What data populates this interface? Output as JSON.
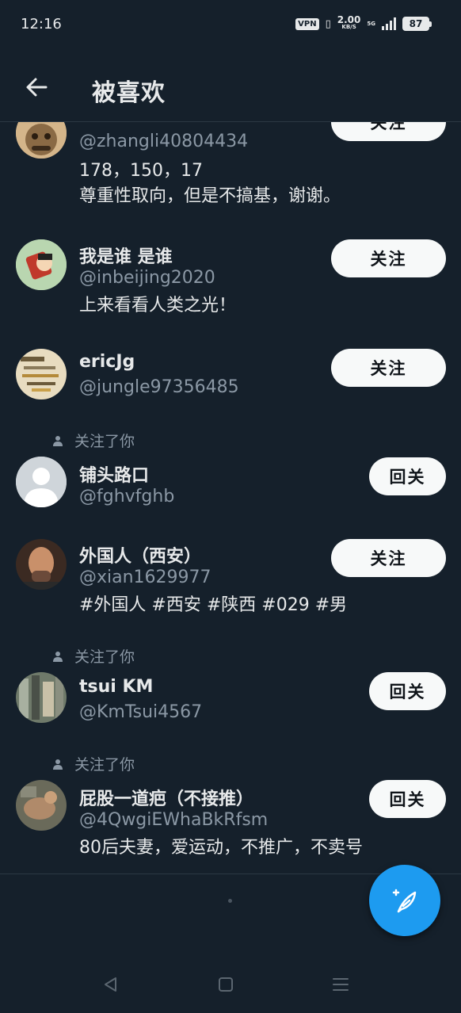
{
  "status_bar": {
    "time": "12:16",
    "vpn": "VPN",
    "speed_value": "2.00",
    "speed_unit": "KB/S",
    "network": "5G",
    "battery": "87"
  },
  "header": {
    "title": "被喜欢"
  },
  "users": [
    {
      "name": "",
      "handle": "@zhangli40804434",
      "bio_lines": [
        "178，150，17",
        "尊重性取向，但是不搞基，谢谢。"
      ],
      "button": "关注",
      "note": ""
    },
    {
      "name": "我是谁 是谁",
      "handle": "@inbeijing2020",
      "bio_lines": [
        "上来看看人类之光！"
      ],
      "button": "关注",
      "note": ""
    },
    {
      "name": "ericJg",
      "handle": "@jungle97356485",
      "bio_lines": [],
      "button": "关注",
      "note": ""
    },
    {
      "name": "铺头路口",
      "handle": "@fghvfghb",
      "bio_lines": [],
      "button": "回关",
      "note": "关注了你"
    },
    {
      "name": "外国人（西安）",
      "handle": "@xian1629977",
      "bio_lines": [
        "#外国人 #西安 #陕西 #029 #男"
      ],
      "button": "关注",
      "note": ""
    },
    {
      "name": "tsui KM",
      "handle": "@KmTsui4567",
      "bio_lines": [],
      "button": "回关",
      "note": "关注了你"
    },
    {
      "name": "屁股一道疤（不接推）",
      "handle": "@4QwgiEWhaBkRfsm",
      "bio_lines": [
        "80后夫妻，爱运动，不推广，不卖号"
      ],
      "button": "回关",
      "note": "关注了你"
    }
  ],
  "icons": {
    "back": "arrow-left-icon",
    "compose": "compose-feather-icon",
    "person": "person-icon",
    "nav_back": "triangle-back-icon",
    "nav_home": "square-home-icon",
    "nav_menu": "menu-lines-icon"
  },
  "colors": {
    "background": "#15202b",
    "accent": "#1d9bf0",
    "secondary_text": "#8b98a5",
    "button_bg": "#f7f9f9"
  }
}
